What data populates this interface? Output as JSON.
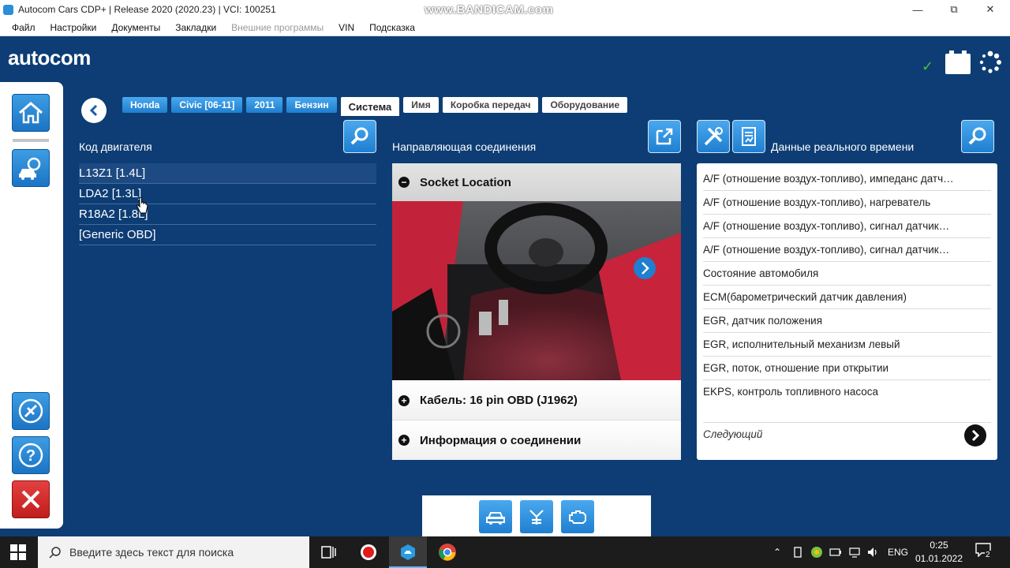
{
  "window": {
    "title": "Autocom Cars CDP+ | Release 2020 (2020.23) | VCI: 100251",
    "watermark": "www.BANDICAM.com"
  },
  "menu": [
    "Файл",
    "Настройки",
    "Документы",
    "Закладки",
    "Внешние программы",
    "VIN",
    "Подсказка"
  ],
  "logo": "autocom",
  "breadcrumbs": {
    "items": [
      "Honda",
      "Civic [06-11]",
      "2011",
      "Бензин"
    ],
    "active": "Система",
    "pending": [
      "Имя",
      "Коробка передач",
      "Оборудование"
    ]
  },
  "engine_panel": {
    "title": "Код двигателя",
    "items": [
      "L13Z1 [1.4L]",
      "LDA2 [1.3L]",
      "R18A2 [1.8L]",
      "[Generic OBD]"
    ]
  },
  "guide_panel": {
    "title": "Направляющая соединения",
    "socket_label": "Socket Location",
    "cable_label": "Кабель: 16 pin OBD (J1962)",
    "info_label": "Информация о соединении"
  },
  "live_panel": {
    "title": "Данные реального времени",
    "items": [
      "A/F (отношение воздух-топливо), импеданс датч…",
      "A/F (отношение воздух-топливо), нагреватель",
      "A/F (отношение воздух-топливо), сигнал датчик…",
      "A/F (отношение воздух-топливо), сигнал датчик…",
      "Состояние автомобиля",
      "ECM(барометрический датчик давления)",
      "EGR, датчик положения",
      "EGR, исполнительный механизм левый",
      "EGR, поток, отношение при открытии",
      "EKPS, контроль топливного насоса"
    ],
    "next_label": "Следующий"
  },
  "taskbar": {
    "search_placeholder": "Введите здесь текст для поиска",
    "lang": "ENG",
    "time": "0:25",
    "date": "01.01.2022",
    "notif_count": "2"
  },
  "colors": {
    "background": "#0d3d74",
    "accent_blue": "#1f7fd0",
    "status_ok": "#3ec43e",
    "exit_red": "#c21d1d"
  }
}
